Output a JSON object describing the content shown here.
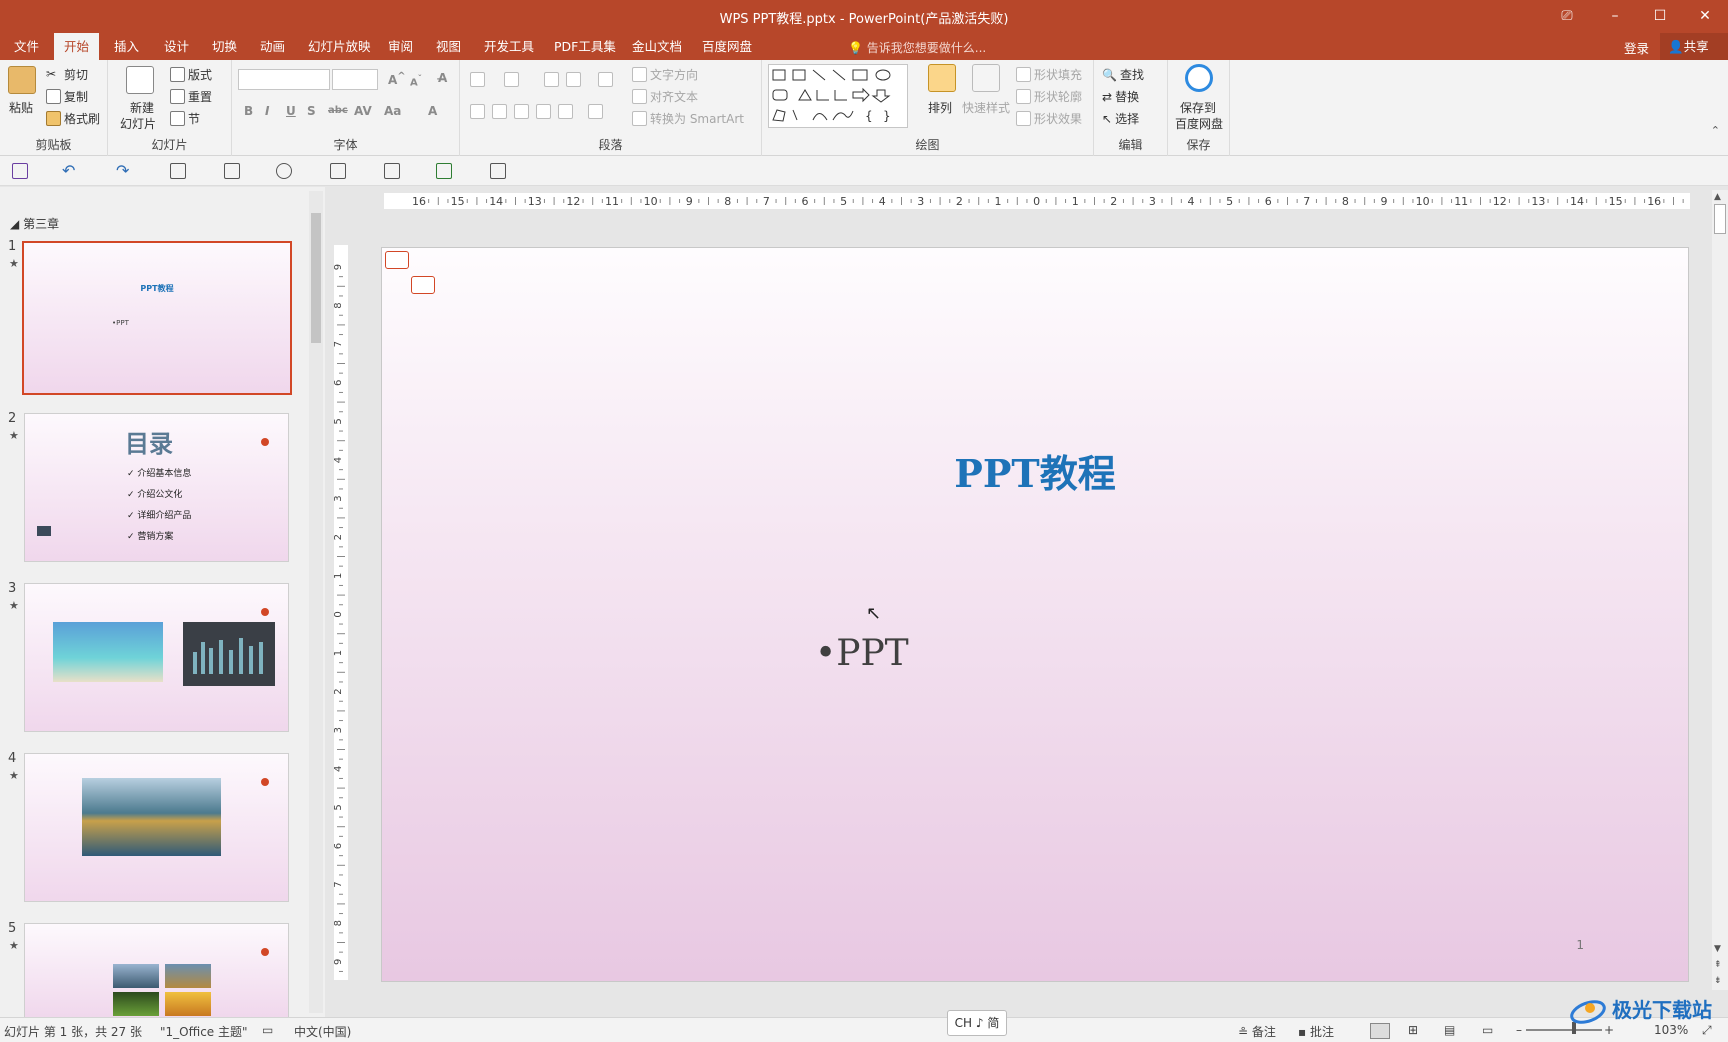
{
  "window": {
    "title": "WPS PPT教程.pptx - PowerPoint(产品激活失败)"
  },
  "tabs": [
    "文件",
    "开始",
    "插入",
    "设计",
    "切换",
    "动画",
    "幻灯片放映",
    "审阅",
    "视图",
    "开发工具",
    "PDF工具集",
    "金山文档",
    "百度网盘"
  ],
  "active_tab": "开始",
  "tellme": "告诉我您想要做什么...",
  "login": "登录",
  "share": "共享",
  "ribbon": {
    "clipboard": {
      "label": "剪贴板",
      "paste": "粘贴",
      "cut": "剪切",
      "copy": "复制",
      "format_painter": "格式刷"
    },
    "slides": {
      "label": "幻灯片",
      "new_slide_1": "新建",
      "new_slide_2": "幻灯片",
      "layout": "版式",
      "reset": "重置",
      "section": "节"
    },
    "font": {
      "label": "字体"
    },
    "paragraph": {
      "label": "段落",
      "text_direction": "文字方向",
      "align_text": "对齐文本",
      "smartart": "转换为 SmartArt"
    },
    "drawing": {
      "label": "绘图",
      "arrange": "排列",
      "quick_styles": "快速样式",
      "shape_fill": "形状填充",
      "shape_outline": "形状轮廓",
      "shape_effects": "形状效果"
    },
    "editing": {
      "label": "编辑",
      "find": "查找",
      "replace": "替换",
      "select": "选择"
    },
    "save": {
      "label": "保存",
      "save_to_1": "保存到",
      "save_to_2": "百度网盘"
    }
  },
  "section_name": "第三章",
  "thumbnails": [
    {
      "num": "1",
      "title": "PPT教程",
      "bullet": "•PPT"
    },
    {
      "num": "2",
      "title": "目录",
      "items": [
        "介绍基本信息",
        "介绍公文化",
        "详细介绍产品",
        "营销方案"
      ]
    },
    {
      "num": "3"
    },
    {
      "num": "4"
    },
    {
      "num": "5"
    }
  ],
  "slide": {
    "title": "PPT教程",
    "bullet": "•PPT",
    "number": "1"
  },
  "ruler": {
    "h_labels": [
      "16",
      "15",
      "14",
      "13",
      "12",
      "11",
      "10",
      "9",
      "8",
      "7",
      "6",
      "5",
      "4",
      "3",
      "2",
      "1",
      "0",
      "1",
      "2",
      "3",
      "4",
      "5",
      "6",
      "7",
      "8",
      "9",
      "10",
      "11",
      "12",
      "13",
      "14",
      "15",
      "16"
    ],
    "v_labels": [
      "9",
      "8",
      "7",
      "6",
      "5",
      "4",
      "3",
      "2",
      "1",
      "0",
      "1",
      "2",
      "3",
      "4",
      "5",
      "6",
      "7",
      "8",
      "9"
    ]
  },
  "statusbar": {
    "slide_info": "幻灯片 第 1 张，共 27 张",
    "theme": "\"1_Office 主题\"",
    "language": "中文(中国)",
    "notes": "备注",
    "comments": "批注",
    "zoom": "103%"
  },
  "ime": "CH ♪ 简",
  "watermark": "极光下载站",
  "colors": {
    "accent": "#b7472a",
    "title_blue": "#1e73b8",
    "selection": "#d24726"
  }
}
